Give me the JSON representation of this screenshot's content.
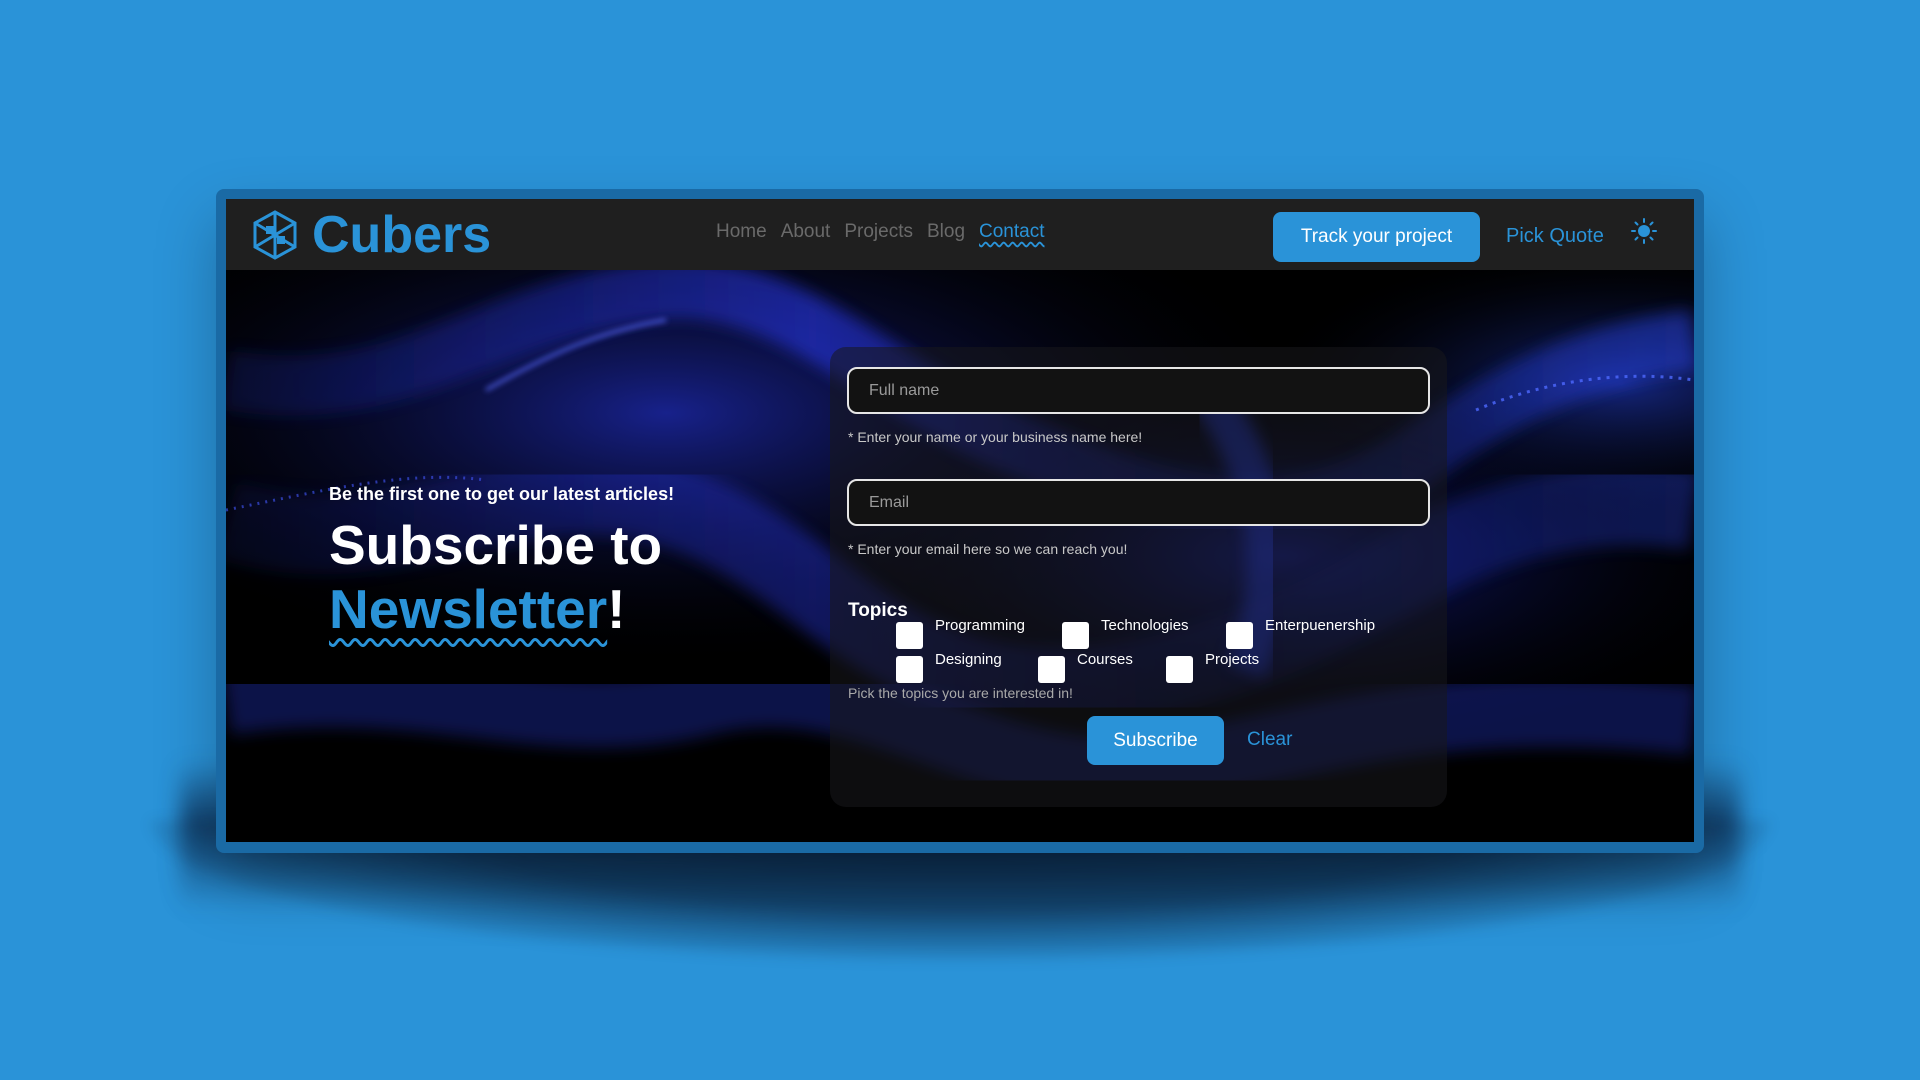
{
  "brand": {
    "name": "Cubers",
    "logo_icon": "cube-logo-icon",
    "color": "#2a93d8"
  },
  "nav": {
    "items": [
      {
        "label": "Home",
        "active": false
      },
      {
        "label": "About",
        "active": false
      },
      {
        "label": "Projects",
        "active": false
      },
      {
        "label": "Blog",
        "active": false
      },
      {
        "label": "Contact",
        "active": true
      }
    ]
  },
  "header_actions": {
    "track_label": "Track your project",
    "quote_label": "Pick Quote",
    "theme_icon": "sun-icon"
  },
  "hero": {
    "kicker": "Be the first one to get our latest articles!",
    "headline_line1": "Subscribe to",
    "headline_accent": "Newsletter",
    "headline_suffix": "!"
  },
  "form": {
    "fullname": {
      "placeholder": "Full name",
      "value": "",
      "hint": "* Enter your name or your business name here!"
    },
    "email": {
      "placeholder": "Email",
      "value": "",
      "hint": "* Enter your email here so we can reach you!"
    },
    "topics_title": "Topics",
    "topics": [
      {
        "label": "Programming",
        "checked": false
      },
      {
        "label": "Technologies",
        "checked": false
      },
      {
        "label": "Enterpuenership",
        "checked": false
      },
      {
        "label": "Designing",
        "checked": false
      },
      {
        "label": "Courses",
        "checked": false
      },
      {
        "label": "Projects",
        "checked": false
      }
    ],
    "topics_hint": "Pick the topics you are interested in!",
    "subscribe_label": "Subscribe",
    "clear_label": "Clear"
  },
  "colors": {
    "background": "#2a93d8",
    "header": "#1f1f1f",
    "accent": "#2a93d8",
    "screen": "#000000"
  }
}
